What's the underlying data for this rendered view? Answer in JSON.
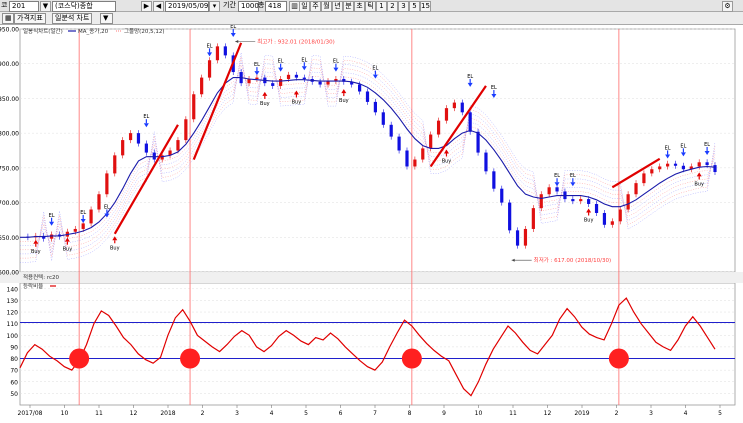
{
  "toolbar": {
    "code_prefix": "코",
    "code": "201",
    "name": "(코스닥)종합",
    "date": "2019/05/09",
    "period_label": "기간",
    "period_value": "1000",
    "count_prefix": "총",
    "count_value": "418",
    "period_buttons": [
      "일",
      "주",
      "월",
      "년",
      "분",
      "초",
      "틱",
      "1",
      "2",
      "3",
      "5",
      "15"
    ],
    "tabs": [
      "가격지표",
      "일분석 차트"
    ],
    "colors": {
      "bg": "#e4e4e4"
    }
  },
  "chart_data": [
    {
      "type": "line",
      "panel": "price",
      "legend": [
        "일봉식차트(일간)",
        "MA_종가,20",
        "그물망(20,5,12)"
      ],
      "x_ticks": [
        "2017/08",
        "10",
        "11",
        "12",
        "2018",
        "2",
        "3",
        "4",
        "5",
        "6",
        "7",
        "8",
        "9",
        "10",
        "11",
        "12",
        "2019",
        "2",
        "3",
        "4",
        "5"
      ],
      "ylim": [
        600,
        950
      ],
      "y_ticks": [
        "950.00",
        "900.00",
        "850.00",
        "800.00",
        "750.00",
        "700.00",
        "650.00",
        "600.00"
      ],
      "series": [
        {
          "values": [
            651,
            650,
            652,
            648,
            654,
            651,
            658,
            662,
            670,
            690,
            712,
            742,
            768,
            790,
            800,
            785,
            772,
            762,
            768,
            775,
            790,
            820,
            856,
            880,
            905,
            925,
            912,
            888,
            872,
            878,
            880,
            872,
            868,
            878,
            884,
            880,
            878,
            874,
            870,
            875,
            878,
            874,
            870,
            860,
            845,
            830,
            812,
            795,
            775,
            752,
            762,
            778,
            798,
            818,
            836,
            844,
            830,
            802,
            772,
            745,
            720,
            700,
            660,
            638,
            662,
            692,
            712,
            722,
            716,
            705,
            702,
            705,
            698,
            685,
            668,
            673,
            690,
            712,
            728,
            742,
            748,
            752,
            756,
            753,
            748,
            752,
            758,
            754,
            744
          ]
        },
        {
          "values": [
            650,
            650,
            651,
            651,
            652,
            652,
            654,
            656,
            659,
            664,
            672,
            684,
            700,
            720,
            742,
            760,
            766,
            766,
            766,
            768,
            773,
            784,
            800,
            818,
            838,
            858,
            872,
            880,
            880,
            878,
            877,
            876,
            875,
            875,
            876,
            877,
            877,
            876,
            875,
            875,
            875,
            875,
            874,
            871,
            866,
            858,
            848,
            836,
            822,
            806,
            792,
            782,
            778,
            778,
            782,
            792,
            800,
            804,
            800,
            790,
            776,
            760,
            742,
            724,
            712,
            708,
            706,
            708,
            710,
            710,
            710,
            710,
            708,
            704,
            698,
            694,
            694,
            698,
            704,
            712,
            720,
            728,
            735,
            741,
            745,
            748,
            751,
            752,
            751
          ]
        }
      ],
      "annotations": [
        {
          "label": "최고가 : 932.01 (2018/01/30)",
          "x": 27,
          "y": 932.01
        },
        {
          "label": "최저가 : 617.00 (2018/10/30)",
          "x": 62,
          "y": 617.0
        }
      ],
      "buy_points": [
        {
          "x": 2,
          "y": 645
        },
        {
          "x": 6,
          "y": 648
        },
        {
          "x": 12,
          "y": 650
        },
        {
          "x": 31,
          "y": 858
        },
        {
          "x": 35,
          "y": 860
        },
        {
          "x": 41,
          "y": 862
        },
        {
          "x": 54,
          "y": 775
        },
        {
          "x": 72,
          "y": 690
        },
        {
          "x": 86,
          "y": 742
        }
      ],
      "buy_label": "Buy",
      "el_points": [
        {
          "x": 4,
          "y": 668
        },
        {
          "x": 8,
          "y": 672
        },
        {
          "x": 11,
          "y": 680
        },
        {
          "x": 16,
          "y": 810
        },
        {
          "x": 24,
          "y": 912
        },
        {
          "x": 27,
          "y": 940
        },
        {
          "x": 30,
          "y": 885
        },
        {
          "x": 33,
          "y": 890
        },
        {
          "x": 36,
          "y": 892
        },
        {
          "x": 40,
          "y": 890
        },
        {
          "x": 45,
          "y": 880
        },
        {
          "x": 57,
          "y": 868
        },
        {
          "x": 60,
          "y": 852
        },
        {
          "x": 68,
          "y": 725
        },
        {
          "x": 70,
          "y": 725
        },
        {
          "x": 82,
          "y": 765
        },
        {
          "x": 84,
          "y": 768
        },
        {
          "x": 87,
          "y": 770
        }
      ],
      "el_label": "EL",
      "trend_segments": [
        [
          12,
          655,
          20,
          812
        ],
        [
          22,
          762,
          28,
          930
        ],
        [
          52,
          752,
          59,
          868
        ],
        [
          75,
          722,
          81,
          763
        ]
      ]
    },
    {
      "type": "line",
      "panel": "indicator",
      "panel_label": "적용컨텍: rc20",
      "legend": [
        "등락비율"
      ],
      "ylim": [
        40,
        145
      ],
      "y_ticks": [
        "140",
        "130",
        "120",
        "110",
        "100",
        "90",
        "80",
        "70",
        "60",
        "50"
      ],
      "reference_lines": [
        111,
        80
      ],
      "markers_y": 80,
      "markers_x": [
        8,
        23,
        53,
        81
      ],
      "values": [
        72,
        85,
        92,
        88,
        82,
        78,
        73,
        70,
        78,
        92,
        110,
        121,
        117,
        108,
        98,
        92,
        84,
        79,
        76,
        81,
        100,
        115,
        122,
        112,
        100,
        95,
        90,
        86,
        92,
        99,
        104,
        100,
        90,
        86,
        91,
        99,
        104,
        100,
        95,
        92,
        98,
        96,
        102,
        97,
        90,
        84,
        78,
        73,
        70,
        77,
        90,
        102,
        113,
        108,
        100,
        93,
        87,
        82,
        78,
        66,
        54,
        48,
        60,
        75,
        88,
        98,
        108,
        102,
        94,
        87,
        84,
        92,
        100,
        114,
        123,
        116,
        107,
        101,
        98,
        96,
        110,
        126,
        132,
        120,
        110,
        102,
        94,
        90,
        87,
        96,
        108,
        116,
        108,
        98,
        88
      ]
    }
  ]
}
